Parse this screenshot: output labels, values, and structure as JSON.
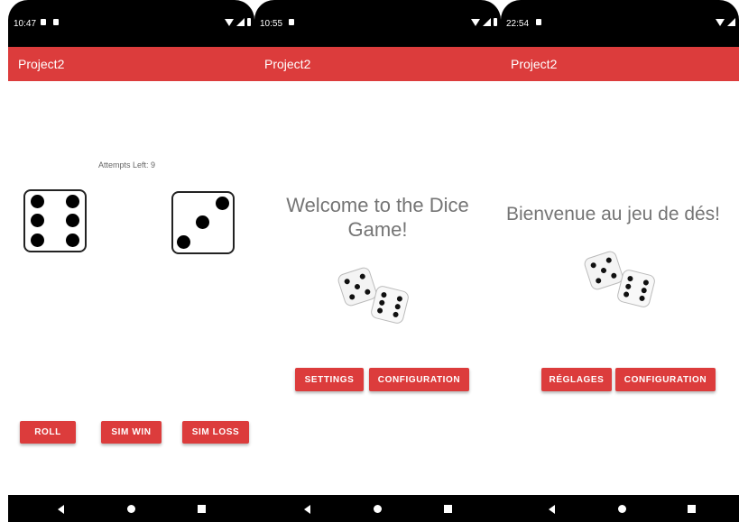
{
  "screens": [
    {
      "status": {
        "time": "10:47"
      },
      "app_bar": {
        "title": "Project2"
      },
      "attempts_text": "Attempts Left: 9",
      "dice": [
        6,
        3
      ],
      "buttons": {
        "roll": "ROLL",
        "sim_win": "SIM WIN",
        "sim_loss": "SIM LOSS"
      }
    },
    {
      "status": {
        "time": "10:55"
      },
      "app_bar": {
        "title": "Project2"
      },
      "welcome": "Welcome to the Dice Game!",
      "buttons": {
        "settings": "SETTINGS",
        "configuration": "CONFIGURATION"
      }
    },
    {
      "status": {
        "time": "22:54"
      },
      "app_bar": {
        "title": "Project2"
      },
      "welcome": "Bienvenue au jeu de dés!",
      "buttons": {
        "settings": "RÉGLAGES",
        "configuration": "CONFIGURATION"
      }
    }
  ],
  "colors": {
    "accent": "#dc3c3c",
    "welcome_text": "#757575"
  },
  "icons": [
    "wifi-icon",
    "signal-icon",
    "battery-icon",
    "back-icon",
    "home-icon",
    "recents-icon",
    "dice-icon"
  ]
}
